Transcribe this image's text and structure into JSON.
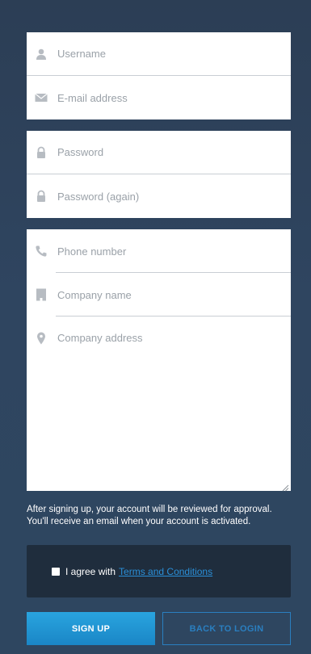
{
  "form": {
    "account": {
      "username_placeholder": "Username",
      "email_placeholder": "E-mail address"
    },
    "security": {
      "password_placeholder": "Password",
      "password_again_placeholder": "Password (again)"
    },
    "company": {
      "phone_placeholder": "Phone number",
      "company_name_placeholder": "Company name",
      "company_address_placeholder": "Company address"
    }
  },
  "notice": {
    "line1": "After signing up, your account will be reviewed for approval.",
    "line2": "You'll receive an email when your account is activated."
  },
  "terms": {
    "agree_text": "I agree with",
    "link_text": "Terms and Conditions",
    "checked": false
  },
  "buttons": {
    "signup_label": "SIGN UP",
    "back_label": "BACK TO LOGIN"
  },
  "icons": {
    "username": "user-icon",
    "email": "envelope-icon",
    "password": "lock-icon",
    "password_again": "lock-icon",
    "phone": "phone-icon",
    "company_name": "building-icon",
    "company_address": "map-pin-icon"
  },
  "colors": {
    "background": "#2e4560",
    "input_background": "#ffffff",
    "icon": "#b7bcc2",
    "link": "#2a8fd8",
    "primary_button": "#1e93d1",
    "secondary_button_border": "#2a7fc0",
    "terms_panel": "#1f2d3d"
  }
}
